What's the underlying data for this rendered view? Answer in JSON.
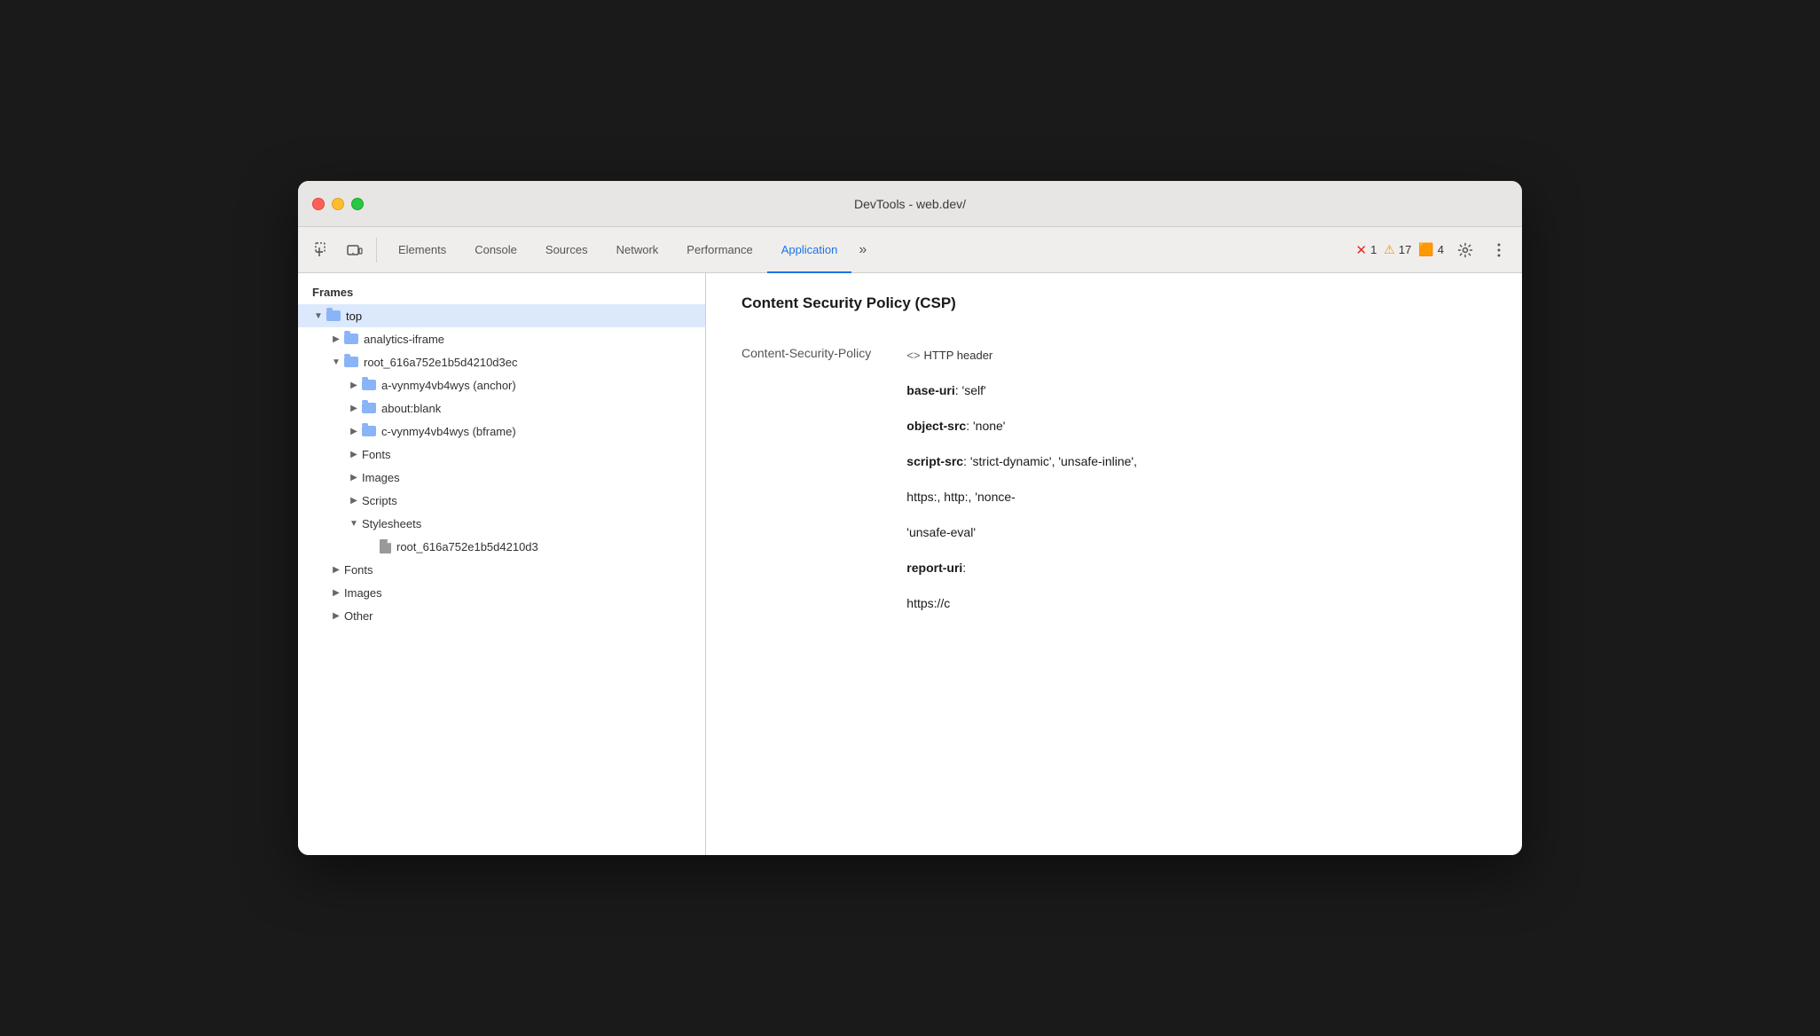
{
  "window": {
    "title": "DevTools - web.dev/"
  },
  "toolbar": {
    "tabs": [
      {
        "id": "elements",
        "label": "Elements",
        "active": false
      },
      {
        "id": "console",
        "label": "Console",
        "active": false
      },
      {
        "id": "sources",
        "label": "Sources",
        "active": false
      },
      {
        "id": "network",
        "label": "Network",
        "active": false
      },
      {
        "id": "performance",
        "label": "Performance",
        "active": false
      },
      {
        "id": "application",
        "label": "Application",
        "active": true
      }
    ],
    "errors": {
      "error_count": "1",
      "warn_count": "17",
      "info_count": "4"
    }
  },
  "sidebar": {
    "section_title": "Frames",
    "items": [
      {
        "id": "top",
        "label": "top",
        "level": 1,
        "arrow": "expanded",
        "icon": "folder",
        "selected": true
      },
      {
        "id": "analytics-iframe",
        "label": "analytics-iframe",
        "level": 2,
        "arrow": "collapsed",
        "icon": "folder",
        "selected": false
      },
      {
        "id": "root-frame",
        "label": "root_616a752e1b5d4210d3ec",
        "level": 2,
        "arrow": "expanded",
        "icon": "folder",
        "selected": false
      },
      {
        "id": "a-vynmy",
        "label": "a-vynmy4vb4wys (anchor)",
        "level": 3,
        "arrow": "collapsed",
        "icon": "folder",
        "selected": false
      },
      {
        "id": "about-blank",
        "label": "about:blank",
        "level": 3,
        "arrow": "collapsed",
        "icon": "folder",
        "selected": false
      },
      {
        "id": "c-vynmy",
        "label": "c-vynmy4vb4wys (bframe)",
        "level": 3,
        "arrow": "collapsed",
        "icon": "folder",
        "selected": false
      },
      {
        "id": "fonts-inner",
        "label": "Fonts",
        "level": 3,
        "arrow": "collapsed",
        "icon": "none",
        "selected": false
      },
      {
        "id": "images-inner",
        "label": "Images",
        "level": 3,
        "arrow": "collapsed",
        "icon": "none",
        "selected": false
      },
      {
        "id": "scripts-inner",
        "label": "Scripts",
        "level": 3,
        "arrow": "collapsed",
        "icon": "none",
        "selected": false
      },
      {
        "id": "stylesheets-inner",
        "label": "Stylesheets",
        "level": 3,
        "arrow": "expanded",
        "icon": "none",
        "selected": false
      },
      {
        "id": "stylesheet-file",
        "label": "root_616a752e1b5d4210d3",
        "level": 4,
        "arrow": "empty",
        "icon": "file",
        "selected": false
      },
      {
        "id": "fonts-outer",
        "label": "Fonts",
        "level": 2,
        "arrow": "collapsed",
        "icon": "none",
        "selected": false
      },
      {
        "id": "images-outer",
        "label": "Images",
        "level": 2,
        "arrow": "collapsed",
        "icon": "none",
        "selected": false
      },
      {
        "id": "other-outer",
        "label": "Other",
        "level": 2,
        "arrow": "collapsed",
        "icon": "none",
        "selected": false
      }
    ]
  },
  "panel": {
    "title": "Content Security Policy (CSP)",
    "rows": [
      {
        "key": "Content-Security-Policy",
        "value_type": "code_tag",
        "value": "HTTP header"
      },
      {
        "key": "",
        "value_type": "bold",
        "value": "base-uri",
        "value_extra": ": 'self'"
      },
      {
        "key": "",
        "value_type": "bold",
        "value": "object-src",
        "value_extra": ": 'none'"
      },
      {
        "key": "",
        "value_type": "bold",
        "value": "script-src",
        "value_extra": ": 'strict-dynamic', 'unsafe-inline',"
      },
      {
        "key": "",
        "value_type": "normal",
        "value": "https:, http:, 'nonce-"
      },
      {
        "key": "",
        "value_type": "normal",
        "value": "'unsafe-eval'"
      },
      {
        "key": "",
        "value_type": "bold",
        "value": "report-uri",
        "value_extra": ":"
      },
      {
        "key": "",
        "value_type": "normal",
        "value": "https://c"
      }
    ]
  }
}
